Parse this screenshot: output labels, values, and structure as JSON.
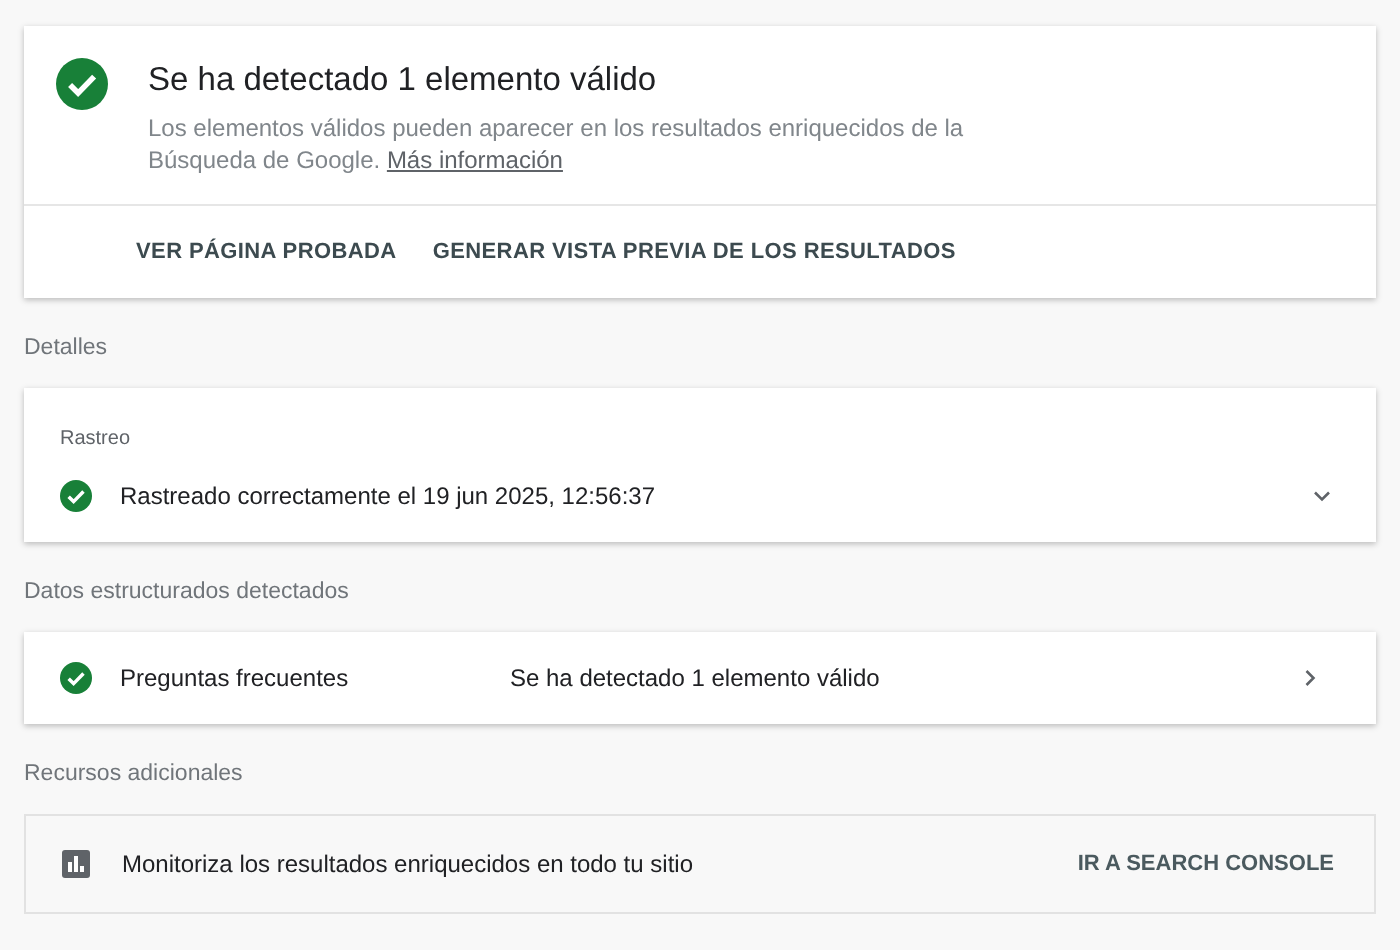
{
  "summary": {
    "valid": true,
    "title": "Se ha detectado 1 elemento válido",
    "description": "Los elementos válidos pueden aparecer en los resultados enriquecidos de la Búsqueda de Google.",
    "link": "Más información",
    "actions": [
      "VER PÁGINA PROBADA",
      "GENERAR VISTA PREVIA DE LOS RESULTADOS"
    ]
  },
  "details": {
    "heading": "Detalles",
    "label": "Rastreo",
    "valid": true,
    "text": "Rastreado correctamente el 19 jun 2025, 12:56:37",
    "expanded": false
  },
  "structured_data": {
    "heading": "Datos estructurados detectados",
    "items": [
      {
        "valid": true,
        "type": "Preguntas frecuentes",
        "result": "Se ha detectado 1 elemento válido"
      }
    ]
  },
  "resources": {
    "heading": "Recursos adicionales",
    "text": "Monitoriza los resultados enriquecidos en todo tu sitio",
    "action": "IR A SEARCH CONSOLE"
  }
}
